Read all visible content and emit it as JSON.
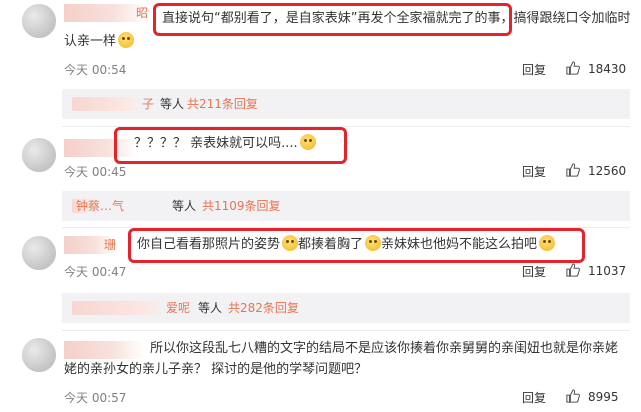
{
  "comments": [
    {
      "name_tail": "昭",
      "text_line1": "直接说句“都别看了，是自家表妹”再发个全家福就完了的事，搞得跟绕口令加临时",
      "text_line2": "认亲一样",
      "time": "今天 00:54",
      "reply_label": "回复",
      "likes": "18430",
      "sub_replies": {
        "name_tail": "子",
        "word": "等人",
        "count": "共211条回复"
      }
    },
    {
      "name_tail": "",
      "text_line1": "？？？？ 亲表妹就可以吗....",
      "time": "今天 00:45",
      "reply_label": "回复",
      "likes": "12560",
      "sub_replies": {
        "name_tail": "钟蔡…气",
        "word": "等人",
        "count": "共1109条回复"
      }
    },
    {
      "name_tail": "珊",
      "text_line1": "你自己看看那照片的姿势",
      "text_line1b": "都揍着胸了",
      "text_line1c": "亲妹妹也他妈不能这么拍吧",
      "time": "今天 00:47",
      "reply_label": "回复",
      "likes": "11037",
      "sub_replies": {
        "name_tail": "爱呢",
        "word": "等人",
        "count": "共282条回复"
      }
    },
    {
      "name_tail": "",
      "text_line1": "所以你这段乱七八糟的文字的结局不是应该你揍着你亲舅舅的亲闺妞也就是你亲姥",
      "text_line2": "姥的亲孙女的亲儿子亲？ 探讨的是他的学琴问题吧？",
      "time": "今天 00:57",
      "reply_label": "回复",
      "likes": "8995"
    }
  ],
  "colors": {
    "highlight": "#e4232b",
    "link": "#eb7350",
    "panel": "#f2f2f5"
  },
  "icons": {
    "like": "thumbs-up-icon",
    "emoji": "smile-emoji-icon"
  }
}
